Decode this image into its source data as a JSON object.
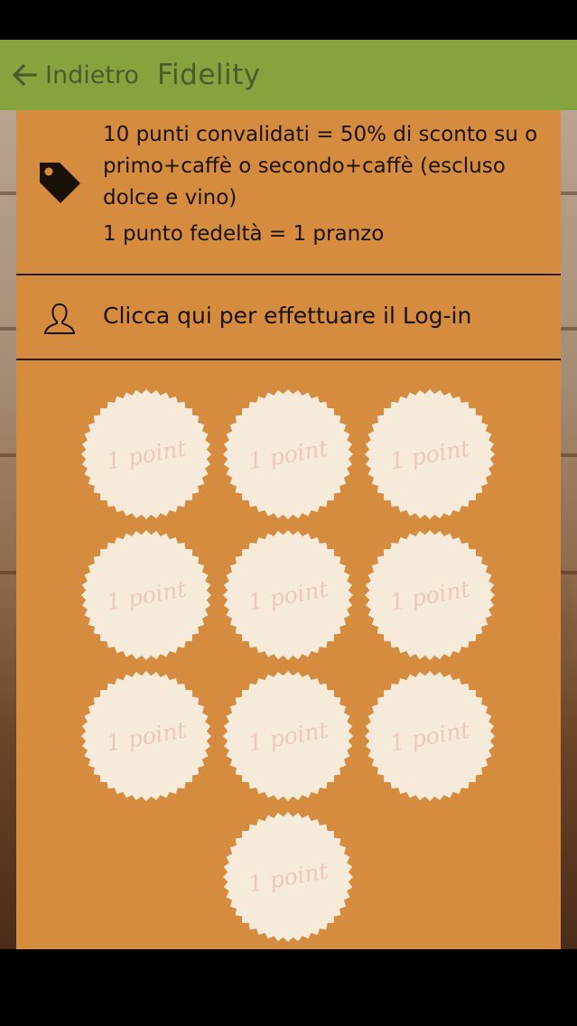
{
  "header": {
    "back_label": "Indietro",
    "title": "Fidelity",
    "back_icon": "arrow-left-icon"
  },
  "promo": {
    "icon": "tag-icon",
    "line1": "10 punti convalidati = 50% di sconto su o primo+caffè o secondo+caffè (escluso dolce e vino)",
    "line2": "1 punto fedeltà = 1 pranzo"
  },
  "login": {
    "icon": "user-icon",
    "label": "Clicca qui per effettuare il Log-in"
  },
  "stamps": {
    "label": "1 point",
    "count": 10,
    "collected": 0
  },
  "colors": {
    "action_bar": "#86a33e",
    "panel": "#d58c3f",
    "stamp_fill": "#f6eadb",
    "stamp_text": "#ecc8b8"
  }
}
